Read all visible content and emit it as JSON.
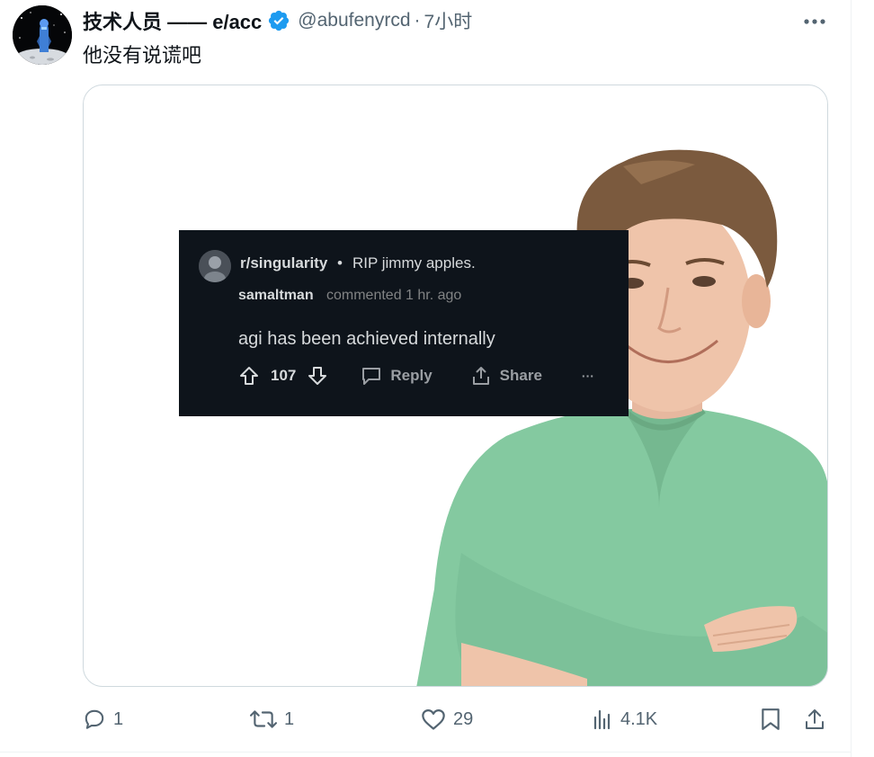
{
  "author": {
    "display_name": "技术人员 —— e/acc",
    "handle": "@abufenyrcd",
    "separator": "·",
    "time": "7小时"
  },
  "tweet": {
    "text": "他没有说谎吧"
  },
  "embedded_reddit": {
    "subreddit": "r/singularity",
    "dot": "•",
    "post_title": "RIP jimmy apples.",
    "username": "samaltman",
    "meta": "commented 1 hr. ago",
    "comment": "agi has been achieved internally",
    "score": "107",
    "reply_label": "Reply",
    "share_label": "Share",
    "more_label": "···"
  },
  "actions": {
    "replies": "1",
    "retweets": "1",
    "likes": "29",
    "views": "4.1K"
  },
  "colors": {
    "accent_verified": "#1d9bf0",
    "text_primary": "#0f1419",
    "text_secondary": "#536471",
    "reddit_bg": "#0e141b",
    "shirt": "#84c9a0"
  }
}
